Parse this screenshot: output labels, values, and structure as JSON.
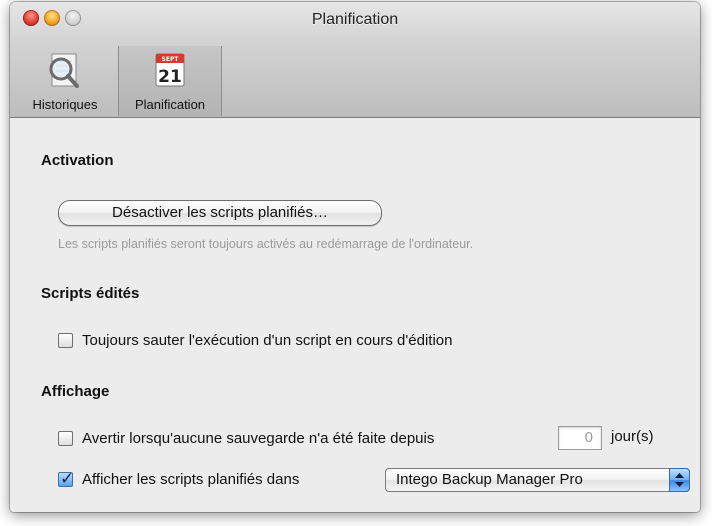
{
  "window": {
    "title": "Planification"
  },
  "toolbar": {
    "items": [
      {
        "label": "Historiques",
        "icon": "magnifier-document-icon",
        "selected": false
      },
      {
        "label": "Planification",
        "icon": "calendar-icon",
        "selected": true,
        "calendar_day": "21",
        "calendar_header": "SEPT"
      }
    ]
  },
  "activation": {
    "title": "Activation",
    "button_label": "Désactiver les scripts planifiés…",
    "hint": "Les scripts planifiés seront toujours activés au redémarrage de l'ordinateur."
  },
  "edited_scripts": {
    "title": "Scripts édités",
    "skip_label": "Toujours sauter l'exécution d'un script en cours d'édition",
    "skip_checked": false
  },
  "display": {
    "title": "Affichage",
    "warn_label": "Avertir lorsqu'aucune sauvegarde n'a été faite depuis",
    "warn_checked": false,
    "days_value": "0",
    "days_unit": "jour(s)",
    "show_label": "Afficher les scripts planifiés dans",
    "show_checked": true,
    "app_select_value": "Intego Backup Manager Pro"
  },
  "colors": {
    "close": "#e4433a",
    "minimize": "#f2a92a",
    "accent_blue": "#5aa2f2"
  }
}
